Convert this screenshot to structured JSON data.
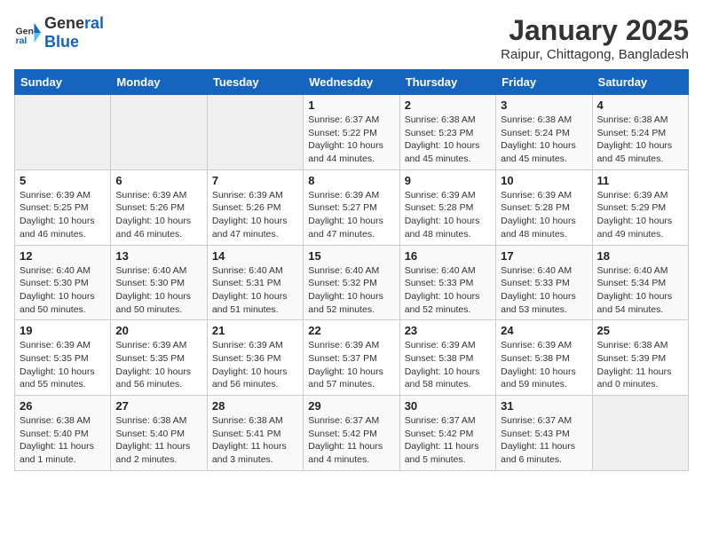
{
  "header": {
    "logo_general": "General",
    "logo_blue": "Blue",
    "month": "January 2025",
    "location": "Raipur, Chittagong, Bangladesh"
  },
  "weekdays": [
    "Sunday",
    "Monday",
    "Tuesday",
    "Wednesday",
    "Thursday",
    "Friday",
    "Saturday"
  ],
  "weeks": [
    [
      {
        "day": "",
        "info": ""
      },
      {
        "day": "",
        "info": ""
      },
      {
        "day": "",
        "info": ""
      },
      {
        "day": "1",
        "info": "Sunrise: 6:37 AM\nSunset: 5:22 PM\nDaylight: 10 hours\nand 44 minutes."
      },
      {
        "day": "2",
        "info": "Sunrise: 6:38 AM\nSunset: 5:23 PM\nDaylight: 10 hours\nand 45 minutes."
      },
      {
        "day": "3",
        "info": "Sunrise: 6:38 AM\nSunset: 5:24 PM\nDaylight: 10 hours\nand 45 minutes."
      },
      {
        "day": "4",
        "info": "Sunrise: 6:38 AM\nSunset: 5:24 PM\nDaylight: 10 hours\nand 45 minutes."
      }
    ],
    [
      {
        "day": "5",
        "info": "Sunrise: 6:39 AM\nSunset: 5:25 PM\nDaylight: 10 hours\nand 46 minutes."
      },
      {
        "day": "6",
        "info": "Sunrise: 6:39 AM\nSunset: 5:26 PM\nDaylight: 10 hours\nand 46 minutes."
      },
      {
        "day": "7",
        "info": "Sunrise: 6:39 AM\nSunset: 5:26 PM\nDaylight: 10 hours\nand 47 minutes."
      },
      {
        "day": "8",
        "info": "Sunrise: 6:39 AM\nSunset: 5:27 PM\nDaylight: 10 hours\nand 47 minutes."
      },
      {
        "day": "9",
        "info": "Sunrise: 6:39 AM\nSunset: 5:28 PM\nDaylight: 10 hours\nand 48 minutes."
      },
      {
        "day": "10",
        "info": "Sunrise: 6:39 AM\nSunset: 5:28 PM\nDaylight: 10 hours\nand 48 minutes."
      },
      {
        "day": "11",
        "info": "Sunrise: 6:39 AM\nSunset: 5:29 PM\nDaylight: 10 hours\nand 49 minutes."
      }
    ],
    [
      {
        "day": "12",
        "info": "Sunrise: 6:40 AM\nSunset: 5:30 PM\nDaylight: 10 hours\nand 50 minutes."
      },
      {
        "day": "13",
        "info": "Sunrise: 6:40 AM\nSunset: 5:30 PM\nDaylight: 10 hours\nand 50 minutes."
      },
      {
        "day": "14",
        "info": "Sunrise: 6:40 AM\nSunset: 5:31 PM\nDaylight: 10 hours\nand 51 minutes."
      },
      {
        "day": "15",
        "info": "Sunrise: 6:40 AM\nSunset: 5:32 PM\nDaylight: 10 hours\nand 52 minutes."
      },
      {
        "day": "16",
        "info": "Sunrise: 6:40 AM\nSunset: 5:33 PM\nDaylight: 10 hours\nand 52 minutes."
      },
      {
        "day": "17",
        "info": "Sunrise: 6:40 AM\nSunset: 5:33 PM\nDaylight: 10 hours\nand 53 minutes."
      },
      {
        "day": "18",
        "info": "Sunrise: 6:40 AM\nSunset: 5:34 PM\nDaylight: 10 hours\nand 54 minutes."
      }
    ],
    [
      {
        "day": "19",
        "info": "Sunrise: 6:39 AM\nSunset: 5:35 PM\nDaylight: 10 hours\nand 55 minutes."
      },
      {
        "day": "20",
        "info": "Sunrise: 6:39 AM\nSunset: 5:35 PM\nDaylight: 10 hours\nand 56 minutes."
      },
      {
        "day": "21",
        "info": "Sunrise: 6:39 AM\nSunset: 5:36 PM\nDaylight: 10 hours\nand 56 minutes."
      },
      {
        "day": "22",
        "info": "Sunrise: 6:39 AM\nSunset: 5:37 PM\nDaylight: 10 hours\nand 57 minutes."
      },
      {
        "day": "23",
        "info": "Sunrise: 6:39 AM\nSunset: 5:38 PM\nDaylight: 10 hours\nand 58 minutes."
      },
      {
        "day": "24",
        "info": "Sunrise: 6:39 AM\nSunset: 5:38 PM\nDaylight: 10 hours\nand 59 minutes."
      },
      {
        "day": "25",
        "info": "Sunrise: 6:38 AM\nSunset: 5:39 PM\nDaylight: 11 hours\nand 0 minutes."
      }
    ],
    [
      {
        "day": "26",
        "info": "Sunrise: 6:38 AM\nSunset: 5:40 PM\nDaylight: 11 hours\nand 1 minute."
      },
      {
        "day": "27",
        "info": "Sunrise: 6:38 AM\nSunset: 5:40 PM\nDaylight: 11 hours\nand 2 minutes."
      },
      {
        "day": "28",
        "info": "Sunrise: 6:38 AM\nSunset: 5:41 PM\nDaylight: 11 hours\nand 3 minutes."
      },
      {
        "day": "29",
        "info": "Sunrise: 6:37 AM\nSunset: 5:42 PM\nDaylight: 11 hours\nand 4 minutes."
      },
      {
        "day": "30",
        "info": "Sunrise: 6:37 AM\nSunset: 5:42 PM\nDaylight: 11 hours\nand 5 minutes."
      },
      {
        "day": "31",
        "info": "Sunrise: 6:37 AM\nSunset: 5:43 PM\nDaylight: 11 hours\nand 6 minutes."
      },
      {
        "day": "",
        "info": ""
      }
    ]
  ]
}
